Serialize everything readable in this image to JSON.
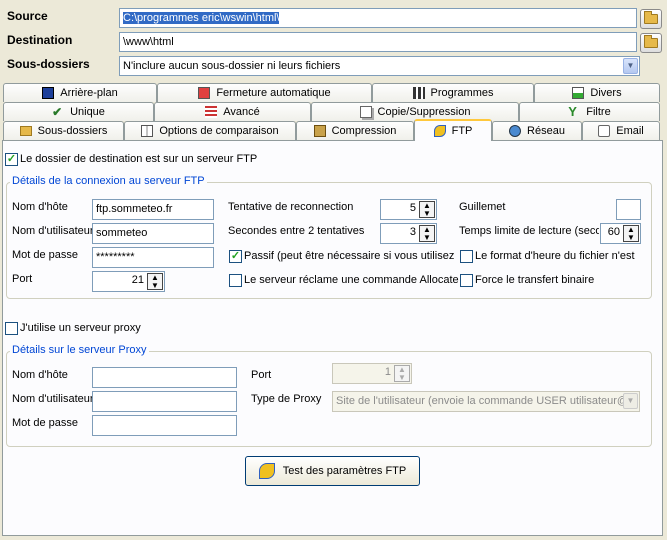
{
  "source": {
    "label": "Source",
    "value": "C:\\programmes eric\\wswin\\html\\"
  },
  "destination": {
    "label": "Destination",
    "value": "\\www\\html"
  },
  "subfolders": {
    "label": "Sous-dossiers",
    "value": "N'inclure aucun sous-dossier ni leurs fichiers"
  },
  "tabs": {
    "row1": [
      "Arrière-plan",
      "Fermeture automatique",
      "Programmes",
      "Divers"
    ],
    "row2": [
      "Unique",
      "Avancé",
      "Copie/Suppression",
      "Filtre"
    ],
    "row3": [
      "Sous-dossiers",
      "Options de comparaison",
      "Compression",
      "FTP",
      "Réseau",
      "Email"
    ]
  },
  "ftp": {
    "dest_is_ftp": "Le dossier de destination est sur un serveur FTP",
    "group_title": "Détails de la connexion au serveur FTP",
    "host_label": "Nom d'hôte",
    "host_value": "ftp.sommeteo.fr",
    "user_label": "Nom d'utilisateur",
    "user_value": "sommeteo",
    "pass_label": "Mot de passe",
    "pass_value": "*********",
    "port_label": "Port",
    "port_value": "21",
    "retry_label": "Tentative de reconnection",
    "retry_value": "5",
    "wait_label": "Secondes entre 2 tentatives",
    "wait_value": "3",
    "passive_label": "Passif (peut être nécessaire si vous utilisez u",
    "allocate_label": "Le serveur réclame une commande Allocate",
    "quote_label": "Guillemet",
    "timeout_label": "Temps limite de lecture (secon",
    "timeout_value": "60",
    "timeformat_label": "Le format d'heure du fichier n'est",
    "binary_label": "Force le transfert binaire"
  },
  "proxy": {
    "use_label": "J'utilise un serveur proxy",
    "group_title": "Détails sur le serveur Proxy",
    "host_label": "Nom d'hôte",
    "user_label": "Nom d'utilisateur",
    "pass_label": "Mot de passe",
    "port_label": "Port",
    "port_value": "1",
    "type_label": "Type de Proxy",
    "type_value": "Site de l'utilisateur (envoie la commande USER utilisateur@n"
  },
  "test_button": "Test des paramètres FTP"
}
